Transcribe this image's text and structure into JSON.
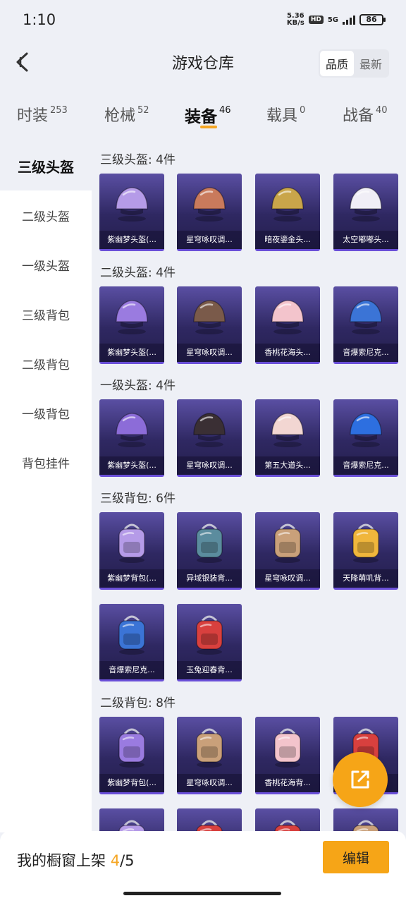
{
  "status_bar": {
    "time": "1:10",
    "speed_value": "5.36",
    "speed_unit": "KB/s",
    "hd": "HD",
    "network": "5G",
    "battery": "86"
  },
  "header": {
    "title": "游戏仓库",
    "sort_options": [
      "品质",
      "最新"
    ],
    "active_sort": "品质"
  },
  "tabs": [
    {
      "label": "时装",
      "count": "253"
    },
    {
      "label": "枪械",
      "count": "52"
    },
    {
      "label": "装备",
      "count": "46",
      "active": true
    },
    {
      "label": "载具",
      "count": "0"
    },
    {
      "label": "战备",
      "count": "40"
    }
  ],
  "sidebar": {
    "items": [
      "三级头盔",
      "二级头盔",
      "一级头盔",
      "三级背包",
      "二级背包",
      "一级背包",
      "背包挂件"
    ],
    "active": "三级头盔"
  },
  "sections": [
    {
      "title": "三级头盔: 4件",
      "items": [
        {
          "name": "紫幽梦头盔(...",
          "art": "helmet-art",
          "tone": "#b59be8"
        },
        {
          "name": "星穹咏叹调...",
          "art": "helmet-art",
          "tone": "#c97a5c"
        },
        {
          "name": "暗夜鎏金头...",
          "art": "helmet-art",
          "tone": "#c9a54a"
        },
        {
          "name": "太空嘟嘟头...",
          "art": "helmet-art",
          "tone": "#f0eef6"
        }
      ]
    },
    {
      "title": "二级头盔: 4件",
      "items": [
        {
          "name": "紫幽梦头盔(...",
          "art": "helmet-art",
          "tone": "#9a7be0"
        },
        {
          "name": "星穹咏叹调...",
          "art": "helmet-art",
          "tone": "#7a5a4a"
        },
        {
          "name": "香桃花海头...",
          "art": "helmet-art",
          "tone": "#f3c4cc"
        },
        {
          "name": "音爆索尼克...",
          "art": "helmet-art",
          "tone": "#3b74d6"
        }
      ]
    },
    {
      "title": "一级头盔: 4件",
      "items": [
        {
          "name": "紫幽梦头盔(...",
          "art": "helmet-art",
          "tone": "#8c6cd8"
        },
        {
          "name": "星穹咏叹调...",
          "art": "helmet-art",
          "tone": "#3a2f34"
        },
        {
          "name": "第五大道头...",
          "art": "helmet-art",
          "tone": "#f2d6d2"
        },
        {
          "name": "音爆索尼克...",
          "art": "helmet-art",
          "tone": "#2d6fe0"
        }
      ]
    },
    {
      "title": "三级背包: 6件",
      "items": [
        {
          "name": "紫幽梦背包(...",
          "art": "backpack-art",
          "tone": "#b59be8"
        },
        {
          "name": "异域银装背...",
          "art": "backpack-art",
          "tone": "#5b8c9e"
        },
        {
          "name": "星穹咏叹调...",
          "art": "backpack-art",
          "tone": "#c9a07a"
        },
        {
          "name": "天降萌叽背...",
          "art": "backpack-art",
          "tone": "#f0b63c"
        },
        {
          "name": "音爆索尼克...",
          "art": "backpack-art",
          "tone": "#3b74d6"
        },
        {
          "name": "玉兔迎春背...",
          "art": "backpack-art",
          "tone": "#d8403e"
        }
      ]
    },
    {
      "title": "二级背包: 8件",
      "items": [
        {
          "name": "紫幽梦背包(...",
          "art": "backpack-art",
          "tone": "#9a7be0"
        },
        {
          "name": "星穹咏叹调...",
          "art": "backpack-art",
          "tone": "#c9a07a"
        },
        {
          "name": "香桃花海背...",
          "art": "backpack-art",
          "tone": "#f3c4cc"
        },
        {
          "name": "",
          "art": "backpack-art",
          "tone": "#d8403e"
        },
        {
          "name": "",
          "art": "backpack-art",
          "tone": "#b59be8"
        },
        {
          "name": "",
          "art": "backpack-art",
          "tone": "#d8403e"
        },
        {
          "name": "",
          "art": "backpack-art",
          "tone": "#d8403e"
        },
        {
          "name": "",
          "art": "backpack-art",
          "tone": "#c9a07a"
        }
      ]
    }
  ],
  "bottom_bar": {
    "shelf_label": "我的橱窗上架",
    "shelf_current": "4",
    "shelf_total": "/5",
    "edit_label": "编辑"
  },
  "fab": {
    "icon": "share-icon"
  },
  "colors": {
    "accent": "#f5a623",
    "card_top": "#5a4fa3",
    "card_bottom": "#241f4d"
  }
}
